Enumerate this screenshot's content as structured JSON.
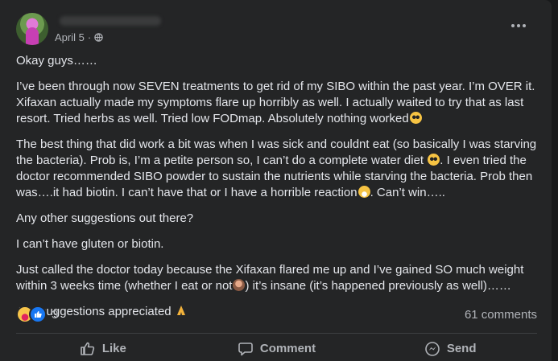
{
  "post": {
    "author_name": "",
    "date": "April 5",
    "separator": " · ",
    "paragraphs": {
      "p1": "Okay guys……",
      "p2": "I’ve been through now SEVEN treatments to get rid of my SIBO within the past year. I’m OVER it. Xifaxan actually made my symptoms flare up horribly as well. I actually waited to try that as last resort. Tried herbs as well. Tried low FODmap. Absolutely nothing worked",
      "p3a": "The best thing that did work a bit was when I was sick and couldnt eat (so basically I was starving the bacteria). Prob is, I’m a petite person so, I can’t do a complete water diet ",
      "p3b": ". I even tried the doctor recommended SIBO powder to sustain the nutrients while starving the bacteria. Prob then was….it had biotin. I can’t have that or I have a horrible reaction",
      "p3c": ". Can’t win…..",
      "p4": "Any other suggestions out there?",
      "p5": "I can’t have gluten or biotin.",
      "p6a": "Just called the doctor today because the Xifaxan flared me up and I’ve gained SO much weight within 3 weeks time (whether I eat or not",
      "p6b": ") it’s insane (it’s happened previously as well)……",
      "p7": "Any suggestions appreciated "
    },
    "reaction_count": "3",
    "comments_count": "61 comments"
  },
  "actions": {
    "like": "Like",
    "comment": "Comment",
    "send": "Send"
  },
  "colors": {
    "background": "#18191a",
    "card": "#242526",
    "text": "#e4e6eb",
    "muted": "#b0b3b8",
    "like_blue": "#1877f2"
  },
  "icons": [
    "globe-icon",
    "more-options-icon",
    "care-reaction-icon",
    "like-reaction-icon",
    "like-icon",
    "comment-icon",
    "send-icon"
  ]
}
